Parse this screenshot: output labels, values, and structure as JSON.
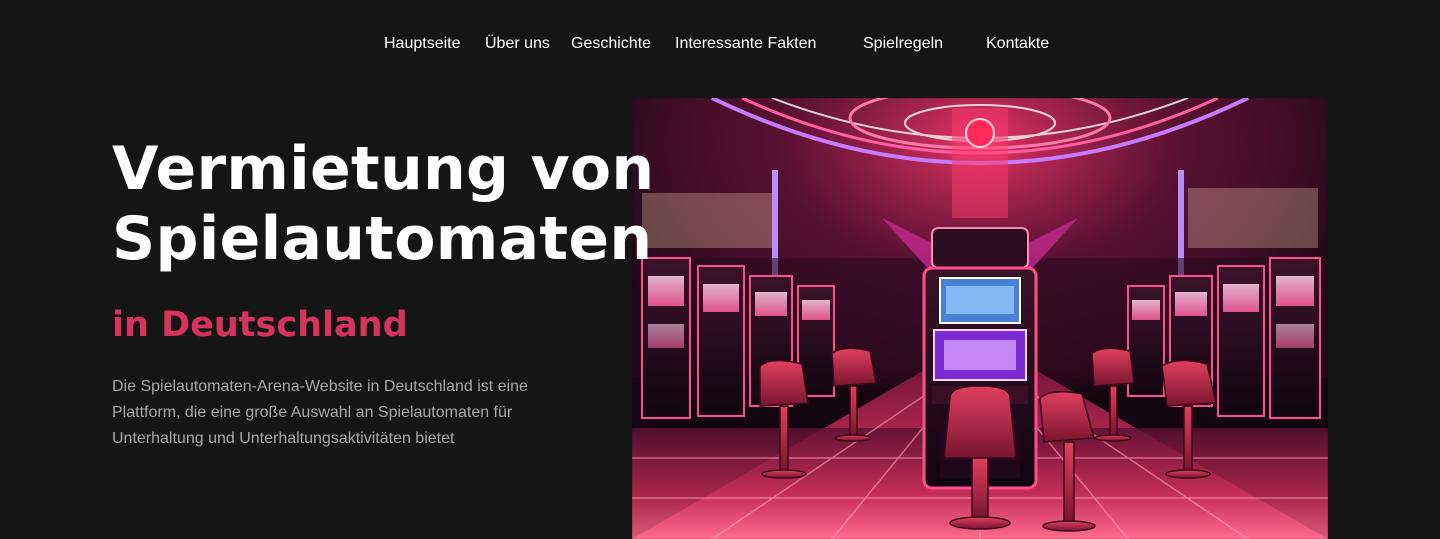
{
  "nav": {
    "items": [
      {
        "label": "Hauptseite"
      },
      {
        "label": "Über uns"
      },
      {
        "label": "Geschichte"
      },
      {
        "label": "Interessante Fakten"
      },
      {
        "label": "Spielregeln"
      },
      {
        "label": "Kontakte"
      }
    ]
  },
  "hero": {
    "title_line1": "Vermietung von",
    "title_line2": "Spielautomaten",
    "subtitle": "in Deutschland",
    "description": "Die Spielautomaten-Arena-Website in Deutschland ist eine Plattform, die eine große Auswahl an Spielautomaten für Unterhaltung und Unterhaltungsaktivitäten bietet",
    "image_alt": "casino-slot-machines-image"
  },
  "colors": {
    "background": "#151515",
    "accent": "#d8325e",
    "text": "#ffffff",
    "muted_text": "#a8a8a8"
  }
}
